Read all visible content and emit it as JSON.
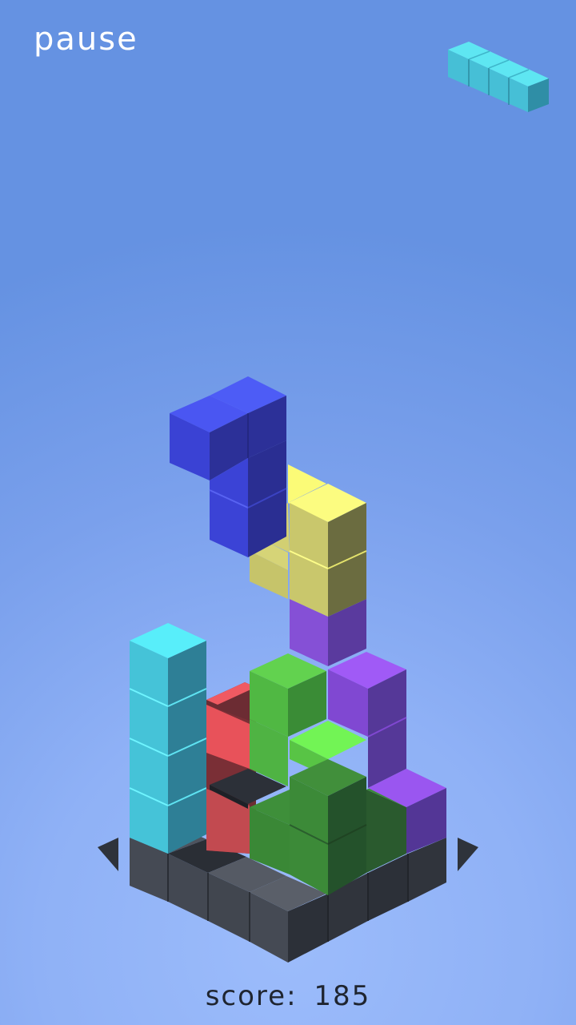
{
  "hud": {
    "pause_label": "pause",
    "score_label": "score:",
    "score_value": "185"
  },
  "next_piece": {
    "shape": "I",
    "color": "#4fd6e6"
  },
  "controls": {
    "left": "rotate-left-arrow-icon",
    "right": "rotate-right-arrow-icon"
  }
}
